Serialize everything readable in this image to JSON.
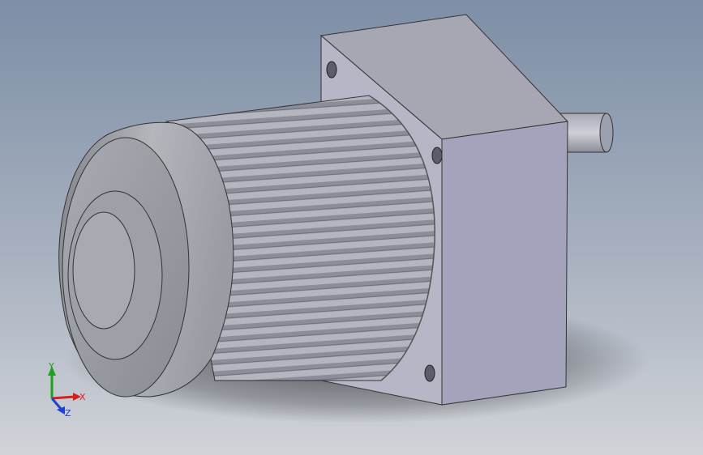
{
  "viewport": {
    "background_top": "#7f8fa6",
    "background_bottom": "#c9ced6"
  },
  "model": {
    "name": "gear-motor",
    "body_color": "#a6a9b0",
    "gearbox_color": "#a4a3bc"
  },
  "triad": {
    "x_label": "X",
    "y_label": "Y",
    "z_label": "Z",
    "x_color": "#d42020",
    "y_color": "#20a020",
    "z_color": "#2040d0"
  }
}
